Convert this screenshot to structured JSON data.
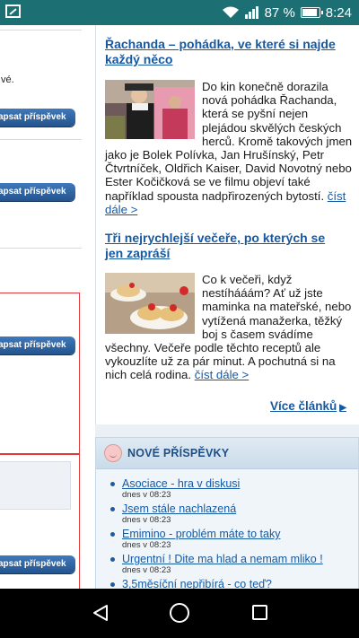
{
  "statusbar": {
    "battery_text": "87 %",
    "time": "8:24"
  },
  "left_column": {
    "fragment_text": "vé.",
    "buttons": [
      "apsat příspěvek",
      "apsat příspěvek",
      "apsat příspěvek",
      "apsat příspěvek"
    ]
  },
  "articles": [
    {
      "title": "Řachanda – pohádka, ve které si najde každý něco",
      "body": "Do kin konečně dorazila nová pohádka Řachanda, která se pyšní nejen plejádou skvělých českých herců. Kromě takových jmen jako je Bolek Polívka, Jan Hrušínský, Petr Čtvrtníček, Oldřich Kaiser, David Novotný nebo Ester Kočičková se ve filmu objeví také například spousta nadpřirozených bytostí.",
      "more": "číst dále >"
    },
    {
      "title": "Tři nejrychlejší večeře, po kterých se jen zapráší",
      "body": "Co k večeři, když nestíhááám? Ať už jste maminka na mateřské, nebo vytížená manažerka, těžký boj s časem svádíme všechny. Večeře podle těchto receptů ale vykouzlíte už za pár minut. A pochutná si na nich celá rodina.",
      "more": "číst dále >"
    }
  ],
  "more_articles": "Více článků",
  "posts": {
    "title": "NOVÉ PŘÍSPĚVKY",
    "items": [
      {
        "title": "Asociace - hra v diskusi",
        "date": "dnes v 08:23"
      },
      {
        "title": "Jsem stále nachlazená",
        "date": "dnes v 08:23"
      },
      {
        "title": "Emimino - problém máte to taky",
        "date": "dnes v 08:23"
      },
      {
        "title": "Urgentní ! Dite ma hlad a nemam mliko !",
        "date": "dnes v 08:23"
      },
      {
        "title": "3,5měsíční nepřibírá - co teď?",
        "date": ""
      }
    ]
  },
  "icons": [
    "image-icon",
    "wifi-icon",
    "signal-icon",
    "battery-icon",
    "back-icon",
    "home-icon",
    "recents-icon",
    "baby-icon"
  ]
}
